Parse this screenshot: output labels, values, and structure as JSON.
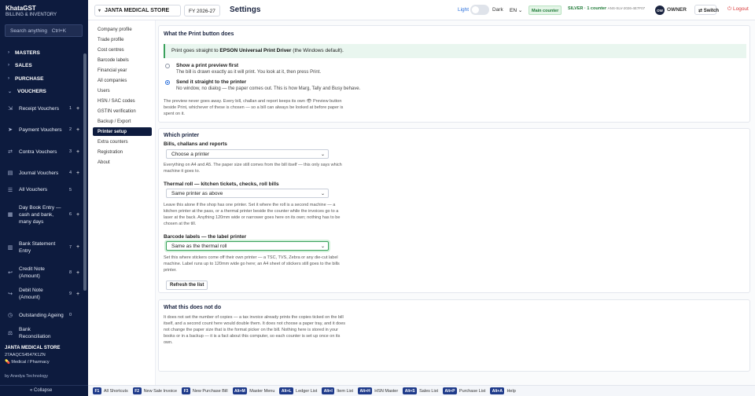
{
  "brand": {
    "name": "KhataGST",
    "tagline": "BILLING & INVENTORY"
  },
  "sidebar": {
    "search_placeholder": "Search anything",
    "search_shortcut": "Ctrl+K",
    "groups": [
      {
        "label": "MASTERS"
      },
      {
        "label": "SALES"
      },
      {
        "label": "PURCHASE"
      },
      {
        "label": "VOUCHERS"
      }
    ],
    "vouchers": [
      {
        "label": "Receipt Vouchers",
        "count": "1",
        "add": "+"
      },
      {
        "label": "Payment Vouchers",
        "count": "2",
        "add": "+"
      },
      {
        "label": "Contra Vouchers",
        "count": "3",
        "add": "+"
      },
      {
        "label": "Journal Vouchers",
        "count": "4",
        "add": "+"
      },
      {
        "label": "All Vouchers",
        "count": "5",
        "add": ""
      },
      {
        "label": "Day Book Entry — cash and bank, many days",
        "count": "6",
        "add": "+"
      },
      {
        "label": "Bank Statement Entry",
        "count": "7",
        "add": "+"
      },
      {
        "label": "Credit Note (Amount)",
        "count": "8",
        "add": "+"
      },
      {
        "label": "Debit Note (Amount)",
        "count": "9",
        "add": "+"
      },
      {
        "label": "Outstanding Ageing",
        "count": "0",
        "add": ""
      },
      {
        "label": "Bank Reconciliation",
        "count": "",
        "add": ""
      }
    ],
    "footer": {
      "company": "JANTA MEDICAL STORE",
      "gstin": "27AAQCS4547K1ZN",
      "business_type": "Medical / Pharmacy",
      "by": "by Anedya Technology",
      "collapse": "« Collapse"
    }
  },
  "topbar": {
    "company": "JANTA MEDICAL STORE",
    "fy": "FY 2026-27",
    "title": "Settings",
    "theme_light": "Light",
    "theme_dark": "Dark",
    "lang": "EN",
    "counter": "Main counter",
    "license": "SILVER · 1 counter",
    "license_code": "ANS-SLV-2026-4E7F07",
    "owner_initials": "OW",
    "owner": "OWNER",
    "switch": "Switch",
    "logout": "Logout"
  },
  "settings_nav": [
    "Company profile",
    "Trade profile",
    "Cost centres",
    "Barcode labels",
    "Financial year",
    "All companies",
    "Users",
    "HSN / SAC codes",
    "GSTIN verification",
    "Backup / Export",
    "Printer setup",
    "Extra counters",
    "Registration",
    "About"
  ],
  "settings_nav_active": "Printer setup",
  "print_button": {
    "heading": "What the Print button does",
    "note_prefix": "Print goes straight to ",
    "note_printer": "EPSON Universal Print Driver",
    "note_suffix": " (the Windows default).",
    "option1_title": "Show a print preview first",
    "option1_desc": "The bill is drawn exactly as it will print. You look at it, then press Print.",
    "option2_title": "Send it straight to the printer",
    "option2_desc": "No window, no dialog — the paper comes out. This is how Marg, Tally and Busy behave.",
    "footnote_line1": "The preview never goes away. Every bill, challan and report keeps its own 👁 Preview button",
    "footnote_line2": "beside Print, whichever of these is chosen — so a bill can always be looked at before paper is",
    "footnote_line3": "spent on it."
  },
  "which_printer": {
    "heading": "Which printer",
    "bills_label": "Bills, challans and reports",
    "bills_value": "Choose a printer",
    "bills_help1": "Everything on A4 and A5. The paper size still comes from the bill itself — this only says which",
    "bills_help2": "machine it goes to.",
    "thermal_label": "Thermal roll — kitchen tickets, checks, roll bills",
    "thermal_value": "Same printer as above",
    "thermal_help1": "Leave this alone if the shop has one printer. Set it where the roll is a second machine — a",
    "thermal_help2": "kitchen printer at the pass, or a thermal printer beside the counter while the invoices go to a",
    "thermal_help3": "laser at the back. Anything 120mm wide or narrower goes here on its own; nothing has to be",
    "thermal_help4": "chosen at the till.",
    "barcode_label": "Barcode labels — the label printer",
    "barcode_value": "Same as the thermal roll",
    "barcode_help1": "Set this where stickers come off their own printer — a TSC, TVS, Zebra or any die-cut label",
    "barcode_help2": "machine. Label runs up to 120mm wide go here; an A4 sheet of stickers still goes to the bills",
    "barcode_help3": "printer.",
    "refresh": "Refresh the list"
  },
  "not_do": {
    "heading": "What this does not do",
    "line1": "It does not set the number of copies — a tax invoice already prints the copies ticked on the bill",
    "line2": "itself, and a second count here would double them. It does not choose a paper tray, and it does",
    "line3": "not change the paper size that is the format picker on the bill. Nothing here is stored in your",
    "line4": "books or in a backup — it is a fact about this computer, so each counter is set up once on its",
    "line5": "own."
  },
  "shortcuts": [
    {
      "key": "F1",
      "label": "All Shortcuts"
    },
    {
      "key": "F2",
      "label": "New Sale Invoice"
    },
    {
      "key": "F3",
      "label": "New Purchase Bill"
    },
    {
      "key": "Alt+M",
      "label": "Master Menu"
    },
    {
      "key": "Alt+L",
      "label": "Ledger List"
    },
    {
      "key": "Alt+I",
      "label": "Item List"
    },
    {
      "key": "Alt+H",
      "label": "HSN Master"
    },
    {
      "key": "Alt+S",
      "label": "Sales List"
    },
    {
      "key": "Alt+P",
      "label": "Purchase List"
    },
    {
      "key": "Alt+A",
      "label": "Help"
    }
  ],
  "colors": {
    "sidebar": "#0d1b3e",
    "accent": "#2a6fdb",
    "success": "#3aa15c",
    "danger": "#d93a3a"
  }
}
